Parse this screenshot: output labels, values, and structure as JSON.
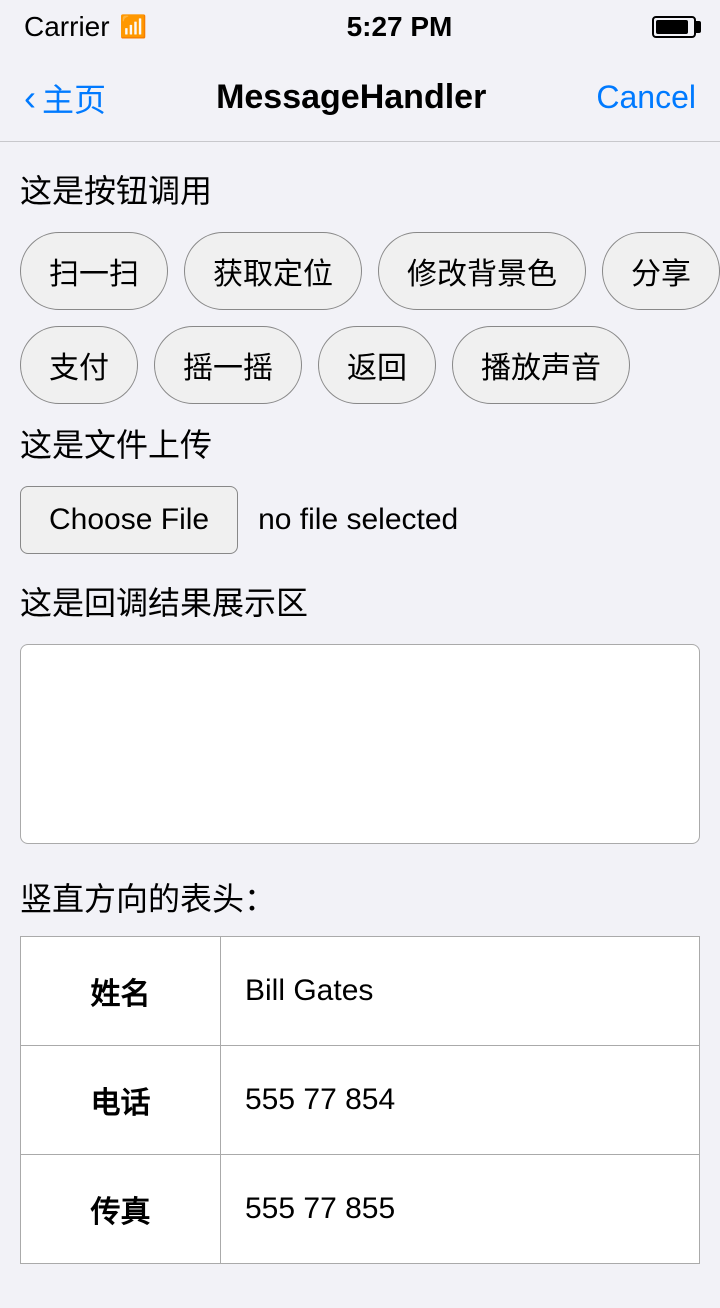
{
  "statusBar": {
    "carrier": "Carrier",
    "time": "5:27 PM"
  },
  "navBar": {
    "backLabel": "主页",
    "title": "MessageHandler",
    "cancelLabel": "Cancel"
  },
  "sections": {
    "buttonSectionLabel": "这是按钮调用",
    "buttonRows": [
      [
        "扫一扫",
        "获取定位",
        "修改背景色",
        "分享"
      ],
      [
        "支付",
        "摇一摇",
        "返回",
        "播放声音"
      ]
    ],
    "fileSectionLabel": "这是文件上传",
    "chooseFileLabel": "Choose File",
    "fileStatus": "no file selected",
    "resultSectionLabel": "这是回调结果展示区",
    "resultContent": "",
    "tableSectionLabel": "竖直方向的表头：",
    "tableRows": [
      {
        "header": "姓名",
        "value": "Bill Gates"
      },
      {
        "header": "电话",
        "value": "555 77 854"
      },
      {
        "header": "传真",
        "value": "555 77 855"
      }
    ]
  }
}
